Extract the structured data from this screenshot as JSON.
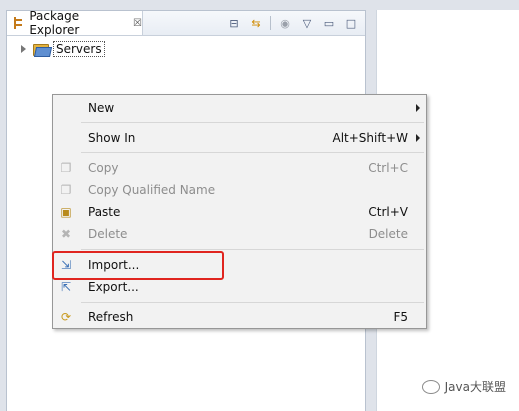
{
  "view": {
    "tab_title": "Package Explorer",
    "tab_close_glyph": "☒",
    "tab_icon": "package-explorer-icon",
    "toolbar": [
      {
        "name": "collapse-all-icon",
        "glyph": "⊟"
      },
      {
        "name": "link-with-editor-icon",
        "glyph": "⇆"
      },
      {
        "name": "focus-active-task-icon",
        "glyph": "◉"
      },
      {
        "name": "view-menu-icon",
        "glyph": "▽"
      },
      {
        "name": "minimize-icon",
        "glyph": "▭"
      },
      {
        "name": "maximize-icon",
        "glyph": "□"
      }
    ]
  },
  "tree": {
    "items": [
      {
        "label": "Servers",
        "icon": "folder-icon",
        "expanded": false
      }
    ]
  },
  "context_menu": {
    "items": [
      {
        "label": "New",
        "mnemonic": "w",
        "shortcut": "",
        "submenu": true,
        "enabled": true,
        "icon": ""
      },
      {
        "label": "Show In",
        "mnemonic": "I",
        "shortcut": "Alt+Shift+W",
        "submenu": true,
        "enabled": true,
        "icon": ""
      },
      {
        "label": "Copy",
        "mnemonic": "C",
        "shortcut": "Ctrl+C",
        "submenu": false,
        "enabled": false,
        "icon": "copy-icon"
      },
      {
        "label": "Copy Qualified Name",
        "mnemonic": "Q",
        "shortcut": "",
        "submenu": false,
        "enabled": false,
        "icon": "copy-qualified-name-icon"
      },
      {
        "label": "Paste",
        "mnemonic": "P",
        "shortcut": "Ctrl+V",
        "submenu": false,
        "enabled": true,
        "icon": "paste-icon"
      },
      {
        "label": "Delete",
        "mnemonic": "D",
        "shortcut": "Delete",
        "submenu": false,
        "enabled": false,
        "icon": "delete-icon"
      },
      {
        "label": "Import...",
        "mnemonic": "m",
        "shortcut": "",
        "submenu": false,
        "enabled": true,
        "icon": "import-icon",
        "highlighted": true
      },
      {
        "label": "Export...",
        "mnemonic": "o",
        "shortcut": "",
        "submenu": false,
        "enabled": true,
        "icon": "export-icon"
      },
      {
        "label": "Refresh",
        "mnemonic": "f",
        "shortcut": "F5",
        "submenu": false,
        "enabled": true,
        "icon": "refresh-icon"
      }
    ]
  },
  "watermark": {
    "text": "Java大联盟"
  },
  "colors": {
    "highlight_border": "#e0251f",
    "menu_bg": "#f2f2f2",
    "disabled_text": "#8d8d8d"
  }
}
